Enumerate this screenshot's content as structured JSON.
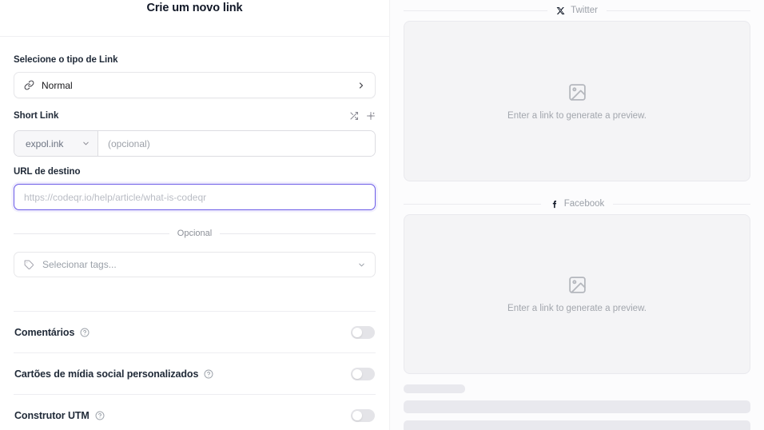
{
  "modal": {
    "title": "Crie um novo link"
  },
  "form": {
    "link_type": {
      "label": "Selecione o tipo de Link",
      "icon": "link-icon",
      "value": "Normal",
      "chevron": "chevron-right-icon"
    },
    "short_link": {
      "label": "Short Link",
      "actions": [
        {
          "name": "randomize-icon",
          "title": "Gerar aleatório"
        },
        {
          "name": "sparkles-ai-icon",
          "title": "Gerar com IA"
        }
      ],
      "domain": "expol.ink",
      "domain_chevron": "chevron-down-icon",
      "key_value": "",
      "key_placeholder": "(opcional)"
    },
    "destination_url": {
      "label": "URL de destino",
      "value": "",
      "placeholder": "https://codeqr.io/help/article/what-is-codeqr",
      "focused": true,
      "focus_color": "#6c5ce7"
    },
    "optional_divider_label": "Opcional",
    "tags": {
      "icon": "tag-icon",
      "placeholder": "Selecionar tags...",
      "chevron": "chevron-down-icon"
    },
    "toggles": [
      {
        "label": "Comentários",
        "help_icon": "help-circle-icon",
        "enabled": false
      },
      {
        "label": "Cartões de mídia social personalizados",
        "help_icon": "help-circle-icon",
        "enabled": false
      },
      {
        "label": "Construtor UTM",
        "help_icon": "help-circle-icon",
        "enabled": false
      }
    ]
  },
  "preview": {
    "twitter": {
      "icon": "x-twitter-icon",
      "label": "Twitter",
      "placeholder_icon": "image-placeholder-icon",
      "placeholder_text": "Enter a link to generate a preview."
    },
    "facebook": {
      "icon": "facebook-icon",
      "label": "Facebook",
      "placeholder_icon": "image-placeholder-icon",
      "placeholder_text": "Enter a link to generate a preview."
    },
    "skeleton_rows": 3
  }
}
